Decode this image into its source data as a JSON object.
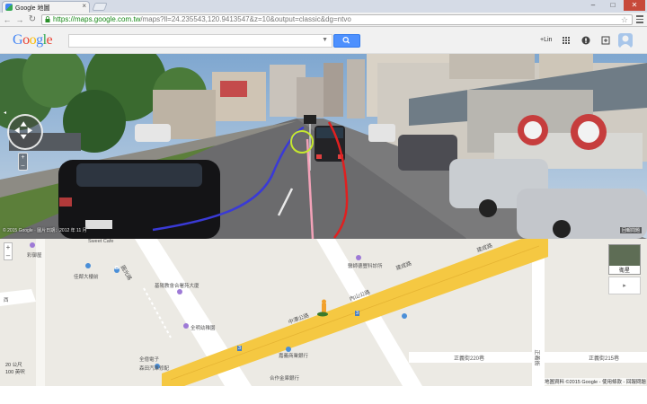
{
  "browser": {
    "tab_title": "Google 地圖",
    "url_scheme": "https://",
    "url_host": "maps.google.com.tw",
    "url_path": "/maps?ll=24.235543,120.9413547&z=10&output=classic&dg=ntvo"
  },
  "header": {
    "logo": "Google",
    "search_placeholder": "",
    "user_label": "+Lin"
  },
  "streetview": {
    "copyright": "© 2015 Google · 圖片日期：2012 年 11 月",
    "report_label": "回報問題"
  },
  "map": {
    "labels": {
      "sweet_cafe": "Sweet Cafe",
      "caipi_wu": "彩御屋",
      "jiahua_fuli": "佳鄰大樓前",
      "yuanguang_road": "圓光路",
      "jiyang_building": "基陽教會合署苑大廈",
      "quanming_kindergarten": "全明幼稚園",
      "yuanfeng_road": "復興路",
      "quanyi_electronic": "全億電子",
      "senqiao_auto": "森田汽車修配",
      "yixin_bank": "嘉義商業銀行",
      "hezuo_bank": "合作金庫銀行",
      "zhongtan_road": "中潭公路",
      "neishan_road": "內山公路",
      "jiancheng_road_1": "建成路",
      "jiancheng_road_2": "建成路",
      "yiren_clinic": "醫師德豐科診所",
      "zhengyi_220": "正義街220巷",
      "zhengyi_street": "正義街",
      "zhengyi_215": "正義街215巷",
      "b_label": "B",
      "road_3a": "3",
      "road_3b": "3",
      "xi_label": "西",
      "satellite": "衛星",
      "scale_top": "20 公尺",
      "scale_bottom": "100 英呎"
    },
    "footer": "地圖資料 ©2015 Google - 使用條款 - 回報問題"
  }
}
